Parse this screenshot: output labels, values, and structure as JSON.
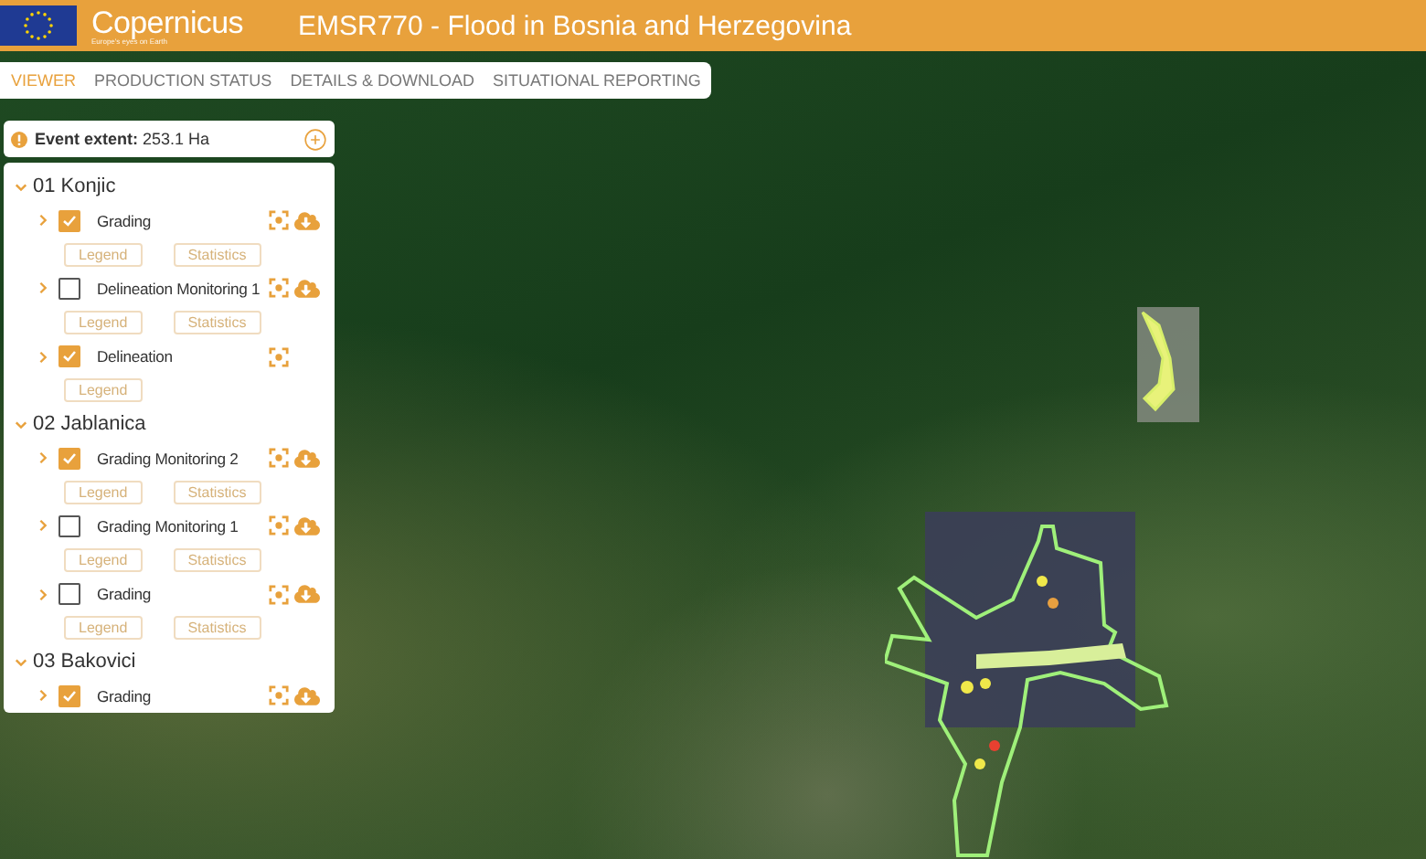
{
  "header": {
    "logo_text": "Copernicus",
    "logo_tagline": "Europe's eyes on Earth",
    "title": "EMSR770 - Flood in Bosnia and Herzegovina"
  },
  "tabs": [
    {
      "label": "VIEWER",
      "selected": true
    },
    {
      "label": "PRODUCTION STATUS",
      "selected": false
    },
    {
      "label": "DETAILS & DOWNLOAD",
      "selected": false
    },
    {
      "label": "SITUATIONAL REPORTING",
      "selected": false
    }
  ],
  "event_extent": "**Event extent:** 253.1 Ha",
  "groups": [
    {
      "name": "01 Konjic",
      "expanded": true,
      "layers": [
        {
          "name": "Grading",
          "checked": true,
          "download": true,
          "buttons": [
            "Legend",
            "Statistics"
          ]
        },
        {
          "name": "Delineation Monitoring 1",
          "checked": false,
          "download": true,
          "buttons": [
            "Legend",
            "Statistics"
          ]
        },
        {
          "name": "Delineation",
          "checked": true,
          "download": false,
          "buttons": [
            "Legend"
          ]
        }
      ]
    },
    {
      "name": "02 Jablanica",
      "expanded": true,
      "layers": [
        {
          "name": "Grading Monitoring 2",
          "checked": true,
          "download": true,
          "buttons": [
            "Legend",
            "Statistics"
          ]
        },
        {
          "name": "Grading Monitoring 1",
          "checked": false,
          "download": true,
          "buttons": [
            "Legend",
            "Statistics"
          ]
        },
        {
          "name": "Grading",
          "checked": false,
          "download": true,
          "buttons": [
            "Legend",
            "Statistics"
          ]
        }
      ]
    },
    {
      "name": "03 Bakovici",
      "expanded": true,
      "layers": [
        {
          "name": "Grading",
          "checked": true,
          "download": true
        }
      ]
    }
  ]
}
